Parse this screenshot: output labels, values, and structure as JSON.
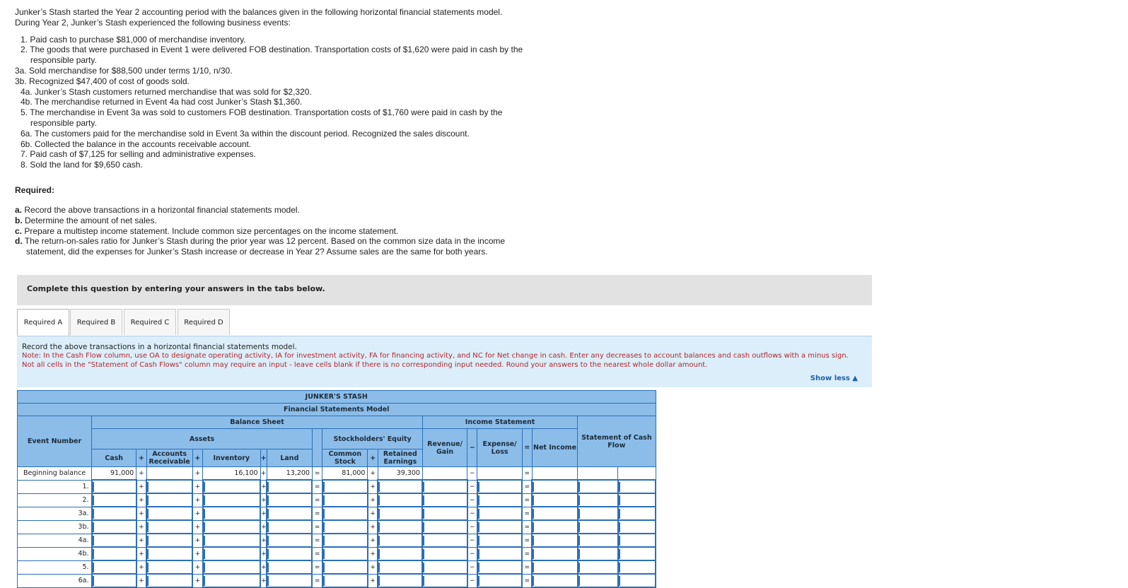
{
  "intro": {
    "line1": "Junker’s Stash started the Year 2 accounting period with the balances given in the following horizontal financial statements model.",
    "line2": "During Year 2, Junker’s Stash experienced the following business events:",
    "events": [
      {
        "text": "1. Paid cash to purchase $81,000 of merchandise inventory.",
        "kind": "main"
      },
      {
        "text": "2. The goods that were purchased in Event 1 were delivered FOB destination. Transportation costs of $1,620 were paid in cash by the",
        "kind": "main"
      },
      {
        "text": "responsible party.",
        "kind": "cont"
      },
      {
        "text": "3a. Sold merchandise for $88,500 under terms 1/10, n/30.",
        "kind": "sub"
      },
      {
        "text": "3b. Recognized $47,400 of cost of goods sold.",
        "kind": "sub"
      },
      {
        "text": "4a. Junker’s Stash customers returned merchandise that was sold for $2,320.",
        "kind": "main"
      },
      {
        "text": "4b. The merchandise returned in Event 4a had cost Junker’s Stash $1,360.",
        "kind": "main"
      },
      {
        "text": "5. The merchandise in Event 3a was sold to customers FOB destination. Transportation costs of $1,760 were paid in cash by the",
        "kind": "main"
      },
      {
        "text": "responsible party.",
        "kind": "cont"
      },
      {
        "text": "6a. The customers paid for the merchandise sold in Event 3a within the discount period. Recognized the sales discount.",
        "kind": "main"
      },
      {
        "text": "6b. Collected the balance in the accounts receivable account.",
        "kind": "main"
      },
      {
        "text": "7. Paid cash of $7,125 for selling and administrative expenses.",
        "kind": "main"
      },
      {
        "text": "8. Sold the land for $9,650 cash.",
        "kind": "main"
      }
    ]
  },
  "required": {
    "heading": "Required:",
    "a_label": "a.",
    "a_text": "Record the above transactions in a horizontal financial statements model.",
    "b_label": "b.",
    "b_text": "Determine the amount of net sales.",
    "c_label": "c.",
    "c_text": "Prepare a multistep income statement. Include common size percentages on the income statement.",
    "d_label": "d.",
    "d_text": "The return-on-sales ratio for Junker’s Stash during the prior year was 12 percent. Based on the common size data in the income",
    "d_cont": "statement, did the expenses for Junker’s Stash increase or decrease in Year 2? Assume sales are the same for both years."
  },
  "instruction_box": "Complete this question by entering your answers in the tabs below.",
  "tabs": [
    "Required A",
    "Required B",
    "Required C",
    "Required D"
  ],
  "panel": {
    "title": "Record the above transactions in a horizontal financial statements model.",
    "note": "Note: In the Cash Flow column, use OA to designate operating activity, IA for investment activity, FA for financing activity, and NC for Net change in cash. Enter any decreases to account balances and cash outflows with a minus sign. Not all cells in the \"Statement of Cash Flows\" column may require an input - leave cells blank if there is no corresponding input needed. Round your answers to the nearest whole dollar amount.",
    "show_less": "Show less ▲"
  },
  "model": {
    "company": "JUNKER'S STASH",
    "subtitle": "Financial Statements Model",
    "balance_sheet": "Balance Sheet",
    "income_statement": "Income Statement",
    "event_number": "Event Number",
    "assets": "Assets",
    "equity": "Stockholders' Equity",
    "revenue": "Revenue/ Gain",
    "expense": "Expense/ Loss",
    "net_income": "Net Income",
    "cash_flow": "Statement of Cash Flow",
    "cash": "Cash",
    "ar": "Accounts Receivable",
    "inventory": "Inventory",
    "land": "Land",
    "common_stock": "Common Stock",
    "retained_earnings": "Retained Earnings",
    "op_plus": "+",
    "op_minus": "−",
    "op_eq": "=",
    "beginning": {
      "label": "Beginning balance",
      "cash": "91,000",
      "inventory": "16,100",
      "land": "13,200",
      "common_stock": "81,000",
      "retained_earnings": "39,300"
    },
    "events": [
      "1.",
      "2.",
      "3a.",
      "3b.",
      "4a.",
      "4b.",
      "5.",
      "6a."
    ]
  }
}
